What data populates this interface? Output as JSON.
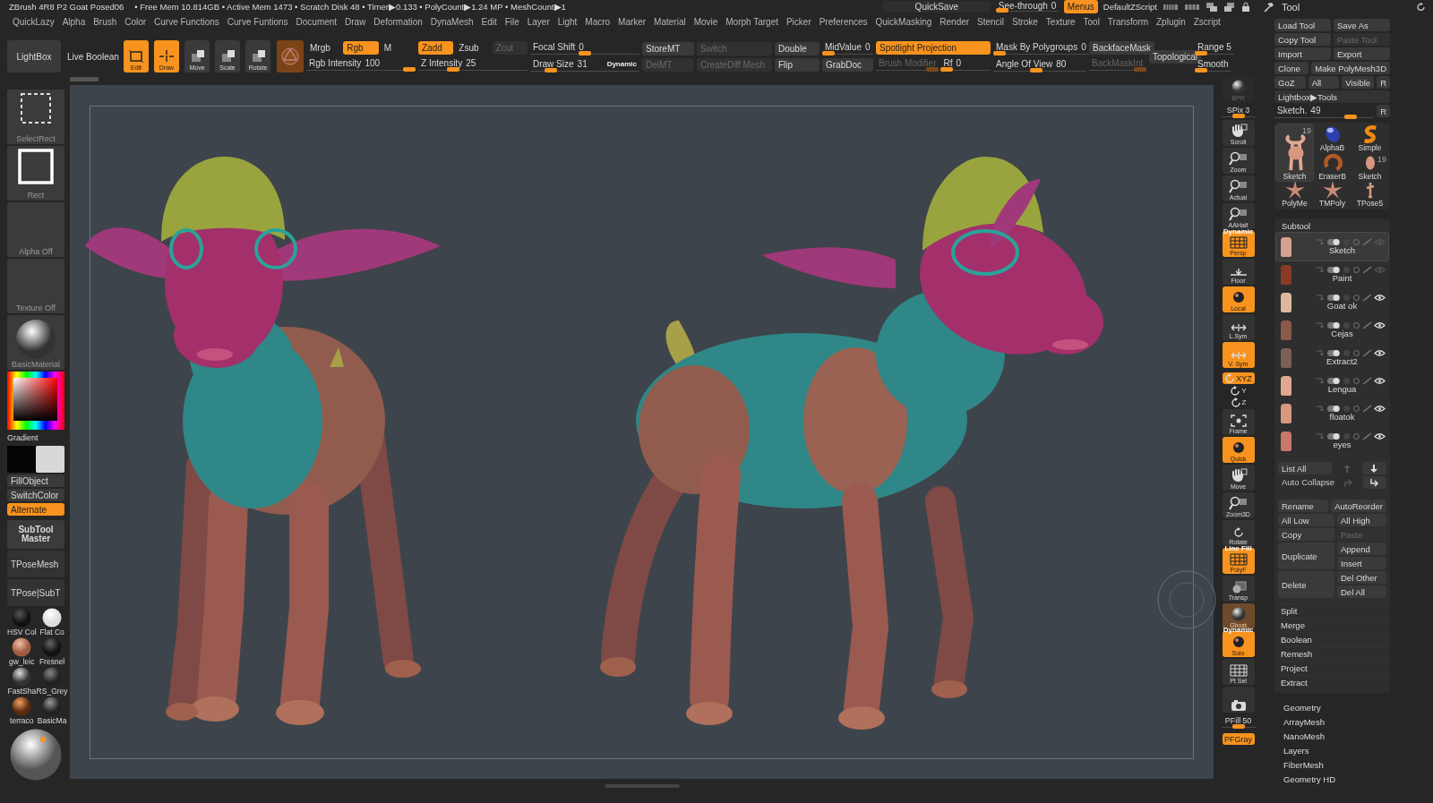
{
  "title_bar": {
    "document": "ZBrush 4R8 P2 Goat Posed06",
    "stats": "• Free Mem 10.814GB • Active Mem 1473 • Scratch Disk 48 •  Timer▶0.133 • PolyCount▶1.24 MP • MeshCount▶1",
    "quicksave": "QuickSave",
    "see_through": {
      "label": "See-through",
      "value": "0",
      "level": 0
    },
    "menus": {
      "label": "Menus",
      "on": true
    },
    "script": "DefaultZScript"
  },
  "menu_bar": [
    "QuickLazy",
    "Alpha",
    "Brush",
    "Color",
    "Curve Functions",
    "Curve Funtions",
    "Document",
    "Draw",
    "Deformation",
    "DynaMesh",
    "Edit",
    "File",
    "Layer",
    "Light",
    "Macro",
    "Marker",
    "Material",
    "Movie",
    "Morph Target",
    "Picker",
    "Preferences",
    "QuickMasking",
    "Render",
    "Stencil",
    "Stroke",
    "Texture",
    "Tool",
    "Transform",
    "Zplugin",
    "Zscript"
  ],
  "toolbar": {
    "lightbox": "LightBox",
    "live_boolean": "Live Boolean",
    "modes": [
      {
        "label": "Edit",
        "on": true
      },
      {
        "label": "Draw",
        "on": true
      },
      {
        "label": "Move",
        "on": false
      },
      {
        "label": "Scale",
        "on": false
      },
      {
        "label": "Rotate",
        "on": false
      }
    ],
    "groups": [
      {
        "rows": [
          [
            {
              "kind": "button",
              "label": "Mrgb",
              "on": false,
              "disabled": false
            },
            {
              "kind": "button",
              "label": "Rgb",
              "on": true,
              "disabled": false
            },
            {
              "kind": "button",
              "label": "M",
              "on": false,
              "disabled": false
            }
          ],
          [
            {
              "kind": "slider",
              "label": "Rgb Intensity",
              "value": "100",
              "level": 1,
              "disabled": false
            }
          ]
        ]
      },
      {
        "rows": [
          [
            {
              "kind": "button",
              "label": "Zadd",
              "on": true,
              "disabled": false
            },
            {
              "kind": "button",
              "label": "Zsub",
              "on": false,
              "disabled": false
            },
            {
              "kind": "button",
              "label": "Zcut",
              "on": false,
              "disabled": true
            }
          ],
          [
            {
              "kind": "slider",
              "label": "Z Intensity",
              "value": "25",
              "level": 0.3,
              "disabled": false
            }
          ]
        ]
      },
      {
        "rows": [
          [
            {
              "kind": "slider",
              "label": "Focal Shift",
              "value": "0",
              "level": 0.5,
              "disabled": false
            }
          ],
          [
            {
              "kind": "slider",
              "label": "Draw Size",
              "value": "31",
              "level": 0.15,
              "disabled": false,
              "badge": "Dynamic"
            }
          ]
        ]
      },
      {
        "rows": [
          [
            {
              "kind": "button",
              "label": "StoreMT",
              "on": false,
              "disabled": false
            }
          ],
          [
            {
              "kind": "button",
              "label": "DelMT",
              "on": false,
              "disabled": true
            }
          ]
        ]
      },
      {
        "rows": [
          [
            {
              "kind": "button",
              "label": "Switch",
              "on": false,
              "disabled": true
            }
          ],
          [
            {
              "kind": "button",
              "label": "CreateDiff Mesh",
              "on": false,
              "disabled": true
            }
          ]
        ]
      },
      {
        "rows": [
          [
            {
              "kind": "button",
              "label": "Double",
              "on": false,
              "disabled": false
            }
          ],
          [
            {
              "kind": "button",
              "label": "Flip",
              "on": false,
              "disabled": false
            }
          ]
        ]
      },
      {
        "rows": [
          [
            {
              "kind": "slider",
              "label": "MidValue",
              "value": "0",
              "level": 0,
              "disabled": false
            }
          ],
          [
            {
              "kind": "button",
              "label": "GrabDoc",
              "on": false,
              "disabled": false
            }
          ]
        ]
      },
      {
        "rows": [
          [
            {
              "kind": "button",
              "label": "Spotlight Projection",
              "on": true,
              "disabled": false
            }
          ],
          [
            {
              "kind": "slider",
              "label": "Brush Modifier",
              "level": 1,
              "disabled": true
            },
            {
              "kind": "slider",
              "label": "Rf",
              "value": "0",
              "level": 0,
              "disabled": false
            }
          ]
        ]
      },
      {
        "rows": [
          [
            {
              "kind": "slider",
              "label": "Mask By Polygroups",
              "value": "0",
              "level": 0,
              "disabled": false
            }
          ],
          [
            {
              "kind": "slider",
              "label": "Angle Of View",
              "value": "80",
              "level": 0.45,
              "disabled": false
            }
          ]
        ]
      },
      {
        "rows": [
          [
            {
              "kind": "button",
              "label": "BackfaceMask",
              "on": false,
              "disabled": false
            }
          ],
          [
            {
              "kind": "slider",
              "label": "BackMaskInt",
              "level": 1,
              "disabled": true
            }
          ]
        ]
      },
      {
        "rows": [
          [
            {
              "kind": "button",
              "label": "Topological",
              "on": false,
              "disabled": false
            }
          ]
        ]
      },
      {
        "rows": [
          [
            {
              "kind": "slider",
              "label": "Range 5",
              "level": 0,
              "disabled": false
            }
          ],
          [
            {
              "kind": "slider",
              "label": "Smooth",
              "level": 0,
              "disabled": false
            }
          ]
        ]
      }
    ]
  },
  "left_shelf": {
    "tiles": [
      "SelectRect",
      "Rect",
      "Alpha Off",
      "Texture Off",
      "BasicMaterial"
    ],
    "gradient": "Gradient",
    "buttons": [
      {
        "label": "FillObject",
        "on": false
      },
      {
        "label": "SwitchColor",
        "on": false
      },
      {
        "label": "Alternate",
        "on": true
      }
    ],
    "subtool_master": "SubTool Master",
    "tpose": [
      "TPoseMesh",
      "TPose|SubT"
    ],
    "materials": [
      "HSV Col",
      "Flat Co",
      "gw_leic",
      "Fresnel",
      "FastSha",
      "RS_Grey",
      "terraco",
      "BasicMa"
    ]
  },
  "right_shelf": [
    {
      "kind": "tall",
      "label": "BPR",
      "on": false,
      "disabled": true
    },
    {
      "kind": "slider",
      "label": "SPix",
      "value": "3",
      "level": 0.5
    },
    {
      "kind": "tall",
      "label": "Scroll",
      "on": false,
      "disabled": false
    },
    {
      "kind": "tall",
      "label": "Zoom",
      "on": false,
      "disabled": false
    },
    {
      "kind": "tall",
      "label": "Actual",
      "on": false,
      "disabled": false
    },
    {
      "kind": "tall",
      "label": "AAHalf",
      "on": false,
      "disabled": false
    },
    {
      "kind": "tall",
      "label": "Persp",
      "on": true,
      "disabled": false,
      "badge": "Dynamic"
    },
    {
      "kind": "tall",
      "label": "Floor",
      "on": false,
      "disabled": false
    },
    {
      "kind": "tall",
      "label": "Local",
      "on": true,
      "disabled": false
    },
    {
      "kind": "tall",
      "label": "L.Sym",
      "on": false,
      "disabled": false
    },
    {
      "kind": "tall",
      "label": "V. Sym",
      "on": true,
      "disabled": false
    },
    {
      "kind": "short",
      "label": "XYZ",
      "on": true,
      "disabled": false
    },
    {
      "kind": "mini",
      "label": "Y"
    },
    {
      "kind": "mini",
      "label": "Z"
    },
    {
      "kind": "tall",
      "label": "Frame",
      "on": false,
      "disabled": false
    },
    {
      "kind": "tall",
      "label": "Quick",
      "on": true,
      "disabled": false
    },
    {
      "kind": "tall",
      "label": "Move",
      "on": false,
      "disabled": false
    },
    {
      "kind": "tall",
      "label": "Zoom3D",
      "on": false,
      "disabled": false
    },
    {
      "kind": "tall",
      "label": "Rotate",
      "on": false,
      "disabled": false
    },
    {
      "kind": "tall",
      "label": "PolyF",
      "on": true,
      "disabled": false,
      "badge": "Line Fill"
    },
    {
      "kind": "tall",
      "label": "Transp",
      "on": false,
      "disabled": false
    },
    {
      "kind": "tall",
      "label": "Ghost",
      "on": true,
      "disabled": true
    },
    {
      "kind": "tall",
      "label": "Solo",
      "on": true,
      "disabled": false,
      "badge": "Dynamic"
    },
    {
      "kind": "tall",
      "label": "Pt Sel",
      "on": false,
      "disabled": false
    },
    {
      "kind": "tall",
      "on": false,
      "disabled": false
    },
    {
      "kind": "slider",
      "label": "PFill",
      "value": "50",
      "level": 0.5
    },
    {
      "kind": "short",
      "label": "PFGray",
      "on": true,
      "disabled": false
    }
  ],
  "tool_panel": {
    "title": "Tool",
    "buttons": [
      [
        {
          "label": "Load Tool",
          "disabled": false
        },
        {
          "label": "Save As",
          "disabled": false
        }
      ],
      [
        {
          "label": "Copy Tool",
          "disabled": false
        },
        {
          "label": "Paste Tool",
          "disabled": true
        }
      ],
      [
        {
          "label": "Import",
          "disabled": false
        },
        {
          "label": "Export",
          "disabled": false
        }
      ],
      [
        {
          "label": "Clone",
          "disabled": false
        },
        {
          "label": "Make PolyMesh3D",
          "disabled": false
        }
      ],
      [
        {
          "label": "GoZ",
          "disabled": false
        },
        {
          "label": "All",
          "disabled": false
        },
        {
          "label": "Visible",
          "disabled": false
        },
        {
          "label": "R",
          "disabled": false
        }
      ],
      [
        {
          "label": "Lightbox▶Tools",
          "disabled": false
        }
      ]
    ],
    "slider": {
      "label": "Sketch.",
      "value": "49",
      "level": 0.8
    },
    "reset": "R",
    "tools": [
      {
        "label": "Sketch",
        "count": "19",
        "selected": true
      },
      {
        "label": "AlphaB",
        "selected": false
      },
      {
        "label": "Simple",
        "selected": false
      },
      {
        "label": "EraserB",
        "selected": false
      },
      {
        "label": "Sketch",
        "count": "19",
        "selected": false
      },
      {
        "label": "PolyMe",
        "selected": false
      },
      {
        "label": "TMPoly",
        "selected": false
      },
      {
        "label": "TPose5",
        "selected": false
      }
    ],
    "subtool": {
      "title": "Subtool",
      "items": [
        {
          "name": "Sketch",
          "selected": true,
          "visible": false
        },
        {
          "name": "Paint",
          "selected": false,
          "visible": false
        },
        {
          "name": "Goat ok",
          "selected": false,
          "visible": true
        },
        {
          "name": "Cejas",
          "selected": false,
          "visible": true
        },
        {
          "name": "Extract2",
          "selected": false,
          "visible": true
        },
        {
          "name": "Lengua",
          "selected": false,
          "visible": true
        },
        {
          "name": "floatok",
          "selected": false,
          "visible": true
        },
        {
          "name": "eyes",
          "selected": false,
          "visible": true
        }
      ],
      "list_all": "List All",
      "auto_collapse": "Auto Collapse",
      "actions": [
        {
          "left": {
            "label": "Rename",
            "disabled": false
          },
          "right": [
            {
              "label": "AutoReorder",
              "disabled": false
            }
          ]
        },
        {
          "left": {
            "label": "All Low",
            "disabled": false
          },
          "right": [
            {
              "label": "All High",
              "disabled": false
            }
          ]
        },
        {
          "left": {
            "label": "Copy",
            "disabled": false
          },
          "right": [
            {
              "label": "Paste",
              "disabled": true
            }
          ]
        },
        {
          "left": {
            "label": "Duplicate",
            "disabled": false
          },
          "right": [
            {
              "label": "Append",
              "disabled": false
            },
            {
              "label": "Insert",
              "disabled": false
            }
          ]
        },
        {
          "left": {
            "label": "Delete",
            "disabled": false
          },
          "right": [
            {
              "label": "Del Other",
              "disabled": false
            },
            {
              "label": "Del All",
              "disabled": false
            }
          ]
        }
      ],
      "commands": [
        "Split",
        "Merge",
        "Boolean",
        "Remesh",
        "Project",
        "Extract"
      ]
    },
    "sections": [
      "Geometry",
      "ArrayMesh",
      "NanoMesh",
      "Layers",
      "FiberMesh",
      "Geometry HD"
    ]
  }
}
